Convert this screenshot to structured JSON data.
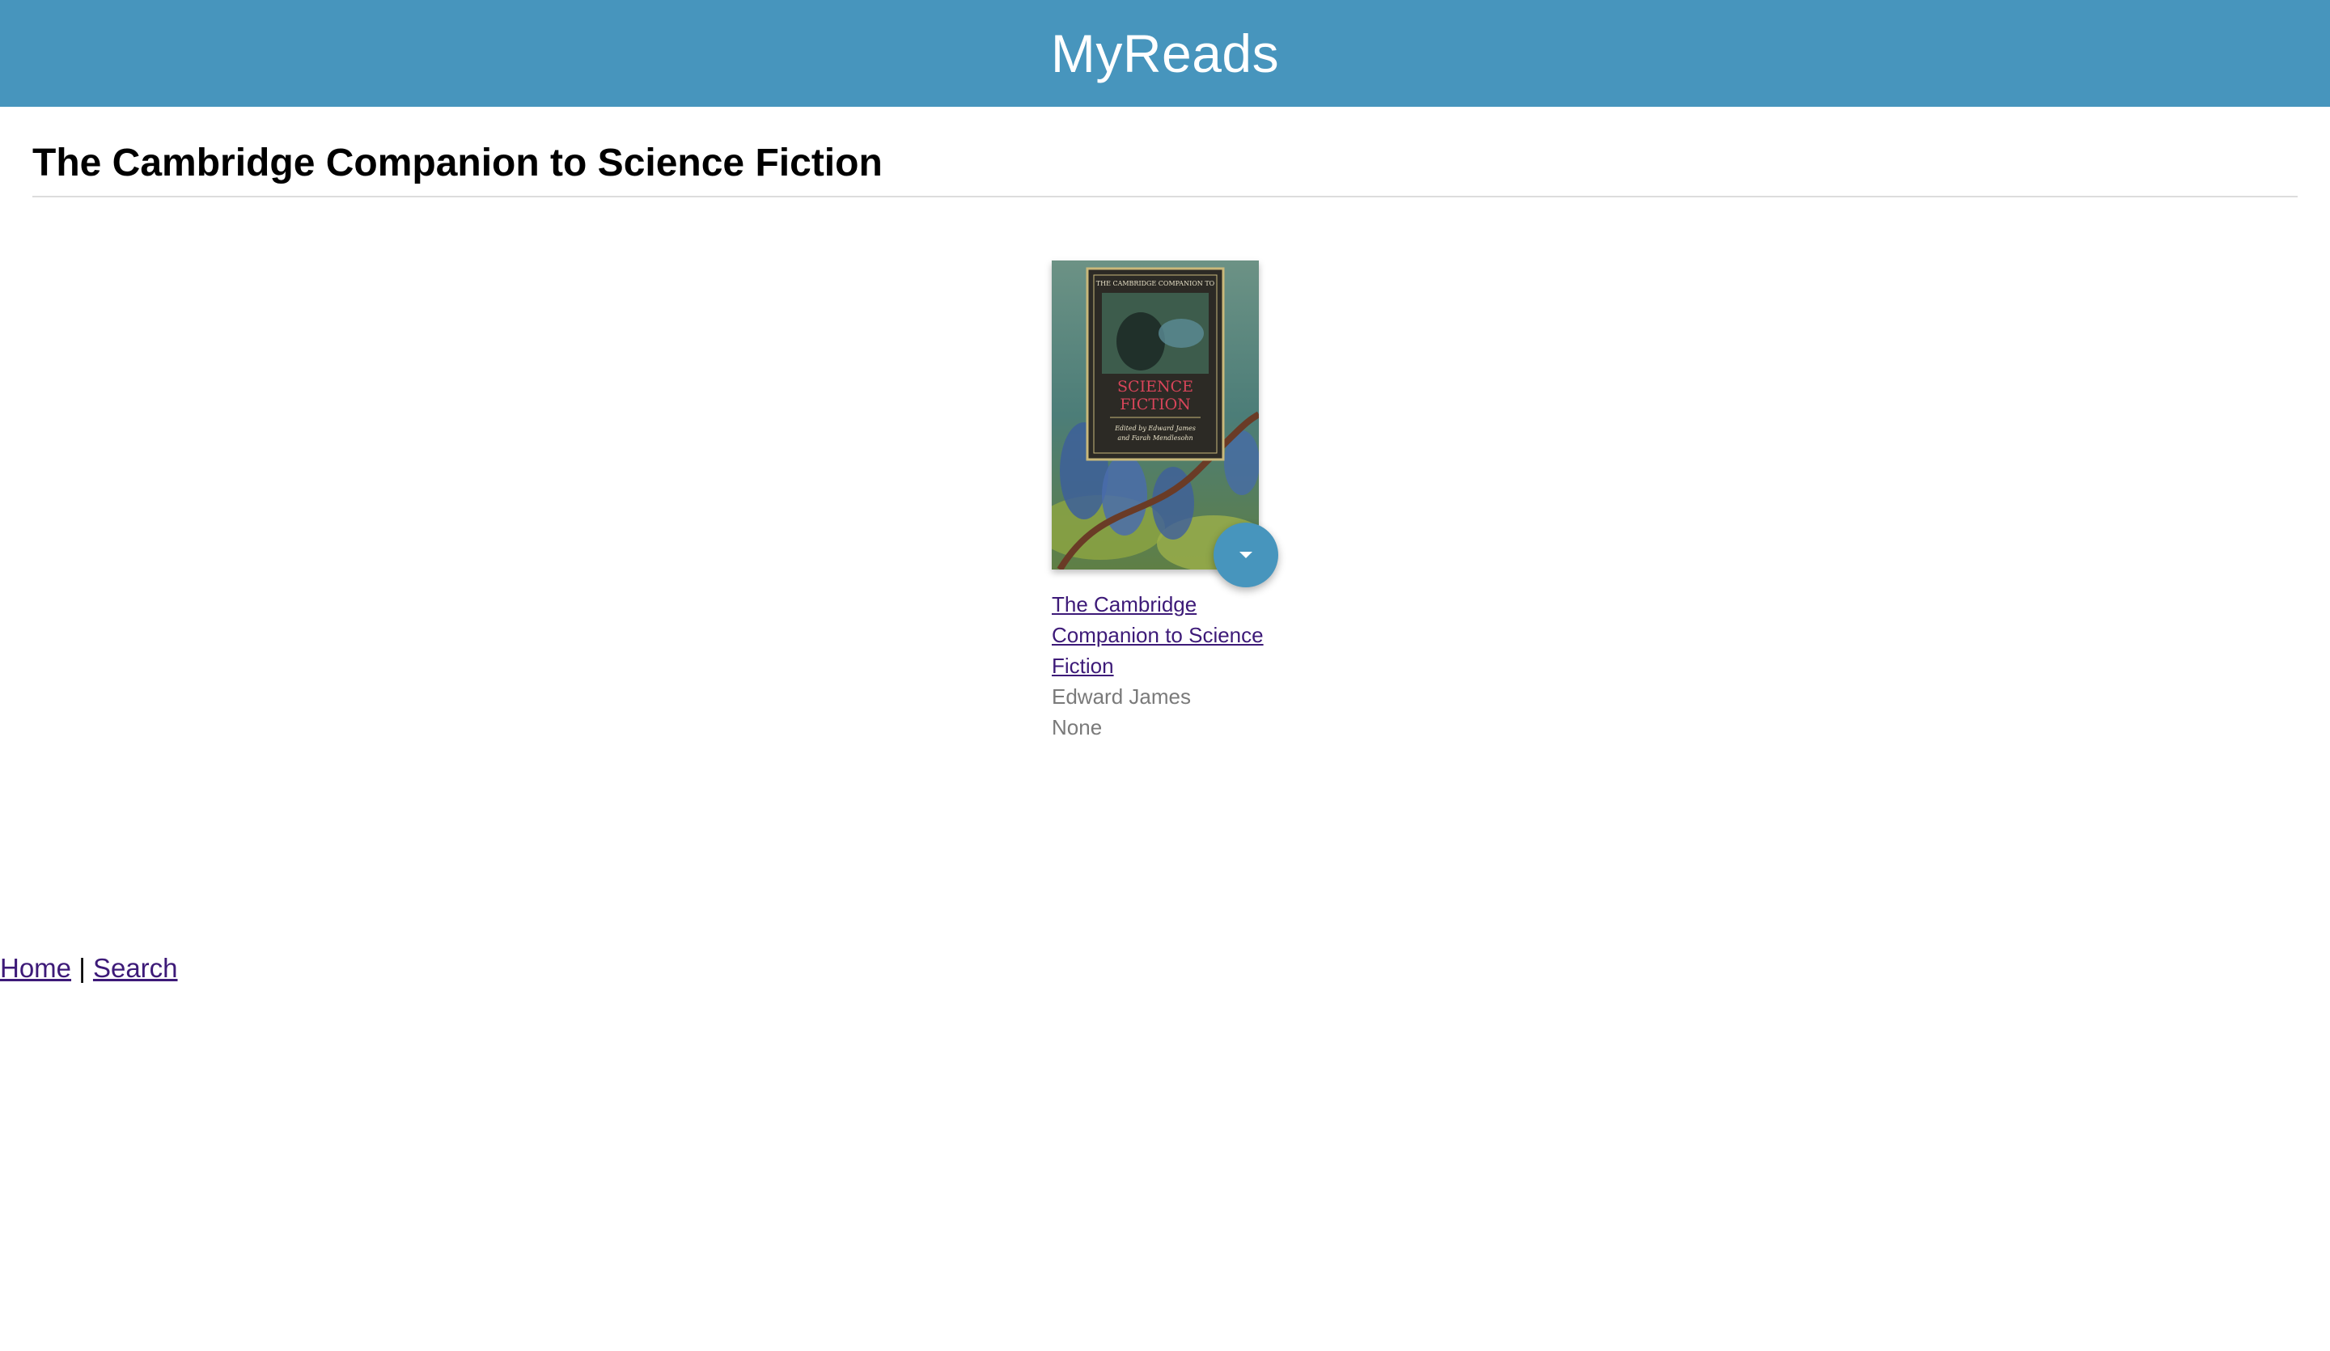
{
  "header": {
    "title": "MyReads"
  },
  "page": {
    "title": "The Cambridge Companion to Science Fiction"
  },
  "book": {
    "title": "The Cambridge Companion to Science Fiction",
    "authors": "Edward James",
    "shelf": "None",
    "cover": {
      "top_text": "THE CAMBRIDGE COMPANION TO",
      "title_line1": "SCIENCE",
      "title_line2": "FICTION",
      "editors_line1": "Edited by Edward James",
      "editors_line2": "and Farah Mendlesohn"
    },
    "shelf_changer_icon": "caret-down-icon"
  },
  "footer": {
    "home_label": "Home",
    "separator": "|",
    "search_label": "Search"
  },
  "colors": {
    "header_bg": "#4795bd",
    "link": "#3d1a78",
    "muted_text": "#7a7a7a",
    "rule": "#dcdcdc"
  }
}
